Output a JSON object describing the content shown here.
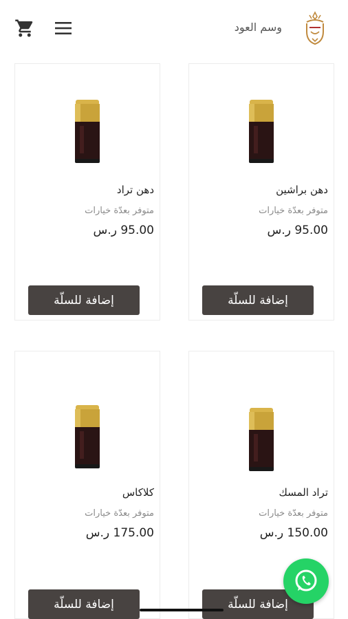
{
  "header": {
    "brand_name": "وسم العود",
    "cart_icon": "cart-icon",
    "menu_icon": "hamburger-menu-icon",
    "logo_icon": "crown-bust-logo"
  },
  "colors": {
    "button_bg": "#484341",
    "whatsapp_green": "#25d366",
    "logo_gold": "#c08a3e"
  },
  "products": [
    {
      "title": "دهن براشين",
      "subtitle": "متوفر بعدّة خيارات",
      "price": "95.00 ر.س",
      "button": "إضافة للسلّة"
    },
    {
      "title": "دهن تراد",
      "subtitle": "متوفر بعدّة خيارات",
      "price": "95.00 ر.س",
      "button": "إضافة للسلّة"
    },
    {
      "title": "تراد المسك",
      "subtitle": "متوفر بعدّة خيارات",
      "price": "150.00 ر.س",
      "button": "إضافة للسلّة"
    },
    {
      "title": "كلاكاس",
      "subtitle": "متوفر بعدّة خيارات",
      "price": "175.00 ر.س",
      "button": "إضافة للسلّة"
    }
  ],
  "floating": {
    "whatsapp_icon": "whatsapp-icon"
  }
}
